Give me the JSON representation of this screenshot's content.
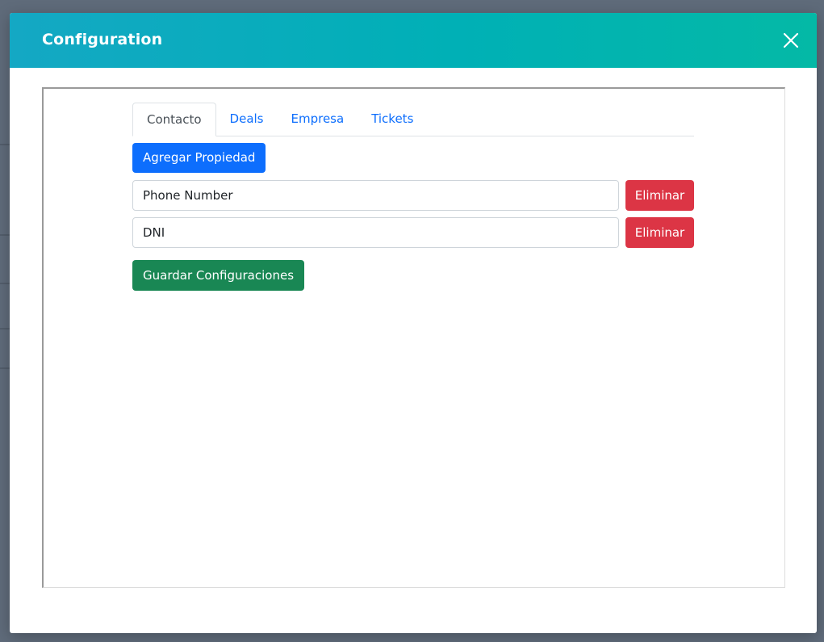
{
  "modal": {
    "title": "Configuration",
    "close_icon": "close-icon"
  },
  "tabs": [
    {
      "label": "Contacto",
      "active": true
    },
    {
      "label": "Deals",
      "active": false
    },
    {
      "label": "Empresa",
      "active": false
    },
    {
      "label": "Tickets",
      "active": false
    }
  ],
  "actions": {
    "add_label": "Agregar Propiedad",
    "save_label": "Guardar Configuraciones"
  },
  "properties": [
    {
      "value": "Phone Number",
      "delete_label": "Eliminar"
    },
    {
      "value": "DNI",
      "delete_label": "Eliminar"
    }
  ],
  "colors": {
    "header_gradient_start": "#14a8c4",
    "header_gradient_end": "#04b9a6",
    "primary": "#0d6efd",
    "danger": "#dc3545",
    "success": "#198754",
    "backdrop": "#5f6b7a"
  }
}
